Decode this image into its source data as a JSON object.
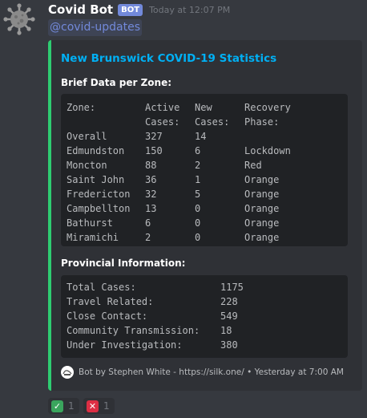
{
  "message": {
    "username": "Covid Bot",
    "bot_tag": "BOT",
    "timestamp": "Today at 12:07 PM",
    "mention": "@covid-updates"
  },
  "embed": {
    "accent_color": "#2ecc71",
    "title": "New Brunswick COVID-19 Statistics",
    "zones_field": {
      "name": "Brief Data per Zone:",
      "header": [
        [
          "Zone:",
          "Active",
          "New",
          "Recovery"
        ],
        [
          "",
          "Cases:",
          "Cases:",
          "Phase:"
        ]
      ],
      "rows": [
        {
          "zone": "Overall",
          "active": "327",
          "new": "14",
          "phase": ""
        },
        {
          "zone": "Edmundston",
          "active": "150",
          "new": "6",
          "phase": "Lockdown"
        },
        {
          "zone": "Moncton",
          "active": "88",
          "new": "2",
          "phase": "Red"
        },
        {
          "zone": "Saint John",
          "active": "36",
          "new": "1",
          "phase": "Orange"
        },
        {
          "zone": "Fredericton",
          "active": "32",
          "new": "5",
          "phase": "Orange"
        },
        {
          "zone": "Campbellton",
          "active": "13",
          "new": "0",
          "phase": "Orange"
        },
        {
          "zone": "Bathurst",
          "active": "6",
          "new": "0",
          "phase": "Orange"
        },
        {
          "zone": "Miramichi",
          "active": "2",
          "new": "0",
          "phase": "Orange"
        }
      ]
    },
    "provincial_field": {
      "name": "Provincial Information:",
      "rows": [
        {
          "label": "Total Cases:",
          "value": "1175"
        },
        {
          "label": "Travel Related:",
          "value": "228"
        },
        {
          "label": "Close Contact:",
          "value": "549"
        },
        {
          "label": "Community Transmission:",
          "value": "18"
        },
        {
          "label": "Under Investigation:",
          "value": "380"
        }
      ]
    },
    "footer": {
      "text": "Bot by Stephen White - https://silk.one/ • Yesterday at 7:00 AM",
      "icon": "silk-logo-icon"
    }
  },
  "reactions": [
    {
      "emoji": "white-check-mark",
      "symbol": "✓",
      "color": "#3aa55d",
      "count": "1"
    },
    {
      "emoji": "cross-mark",
      "symbol": "✕",
      "color": "#dd2e44",
      "count": "1"
    }
  ]
}
